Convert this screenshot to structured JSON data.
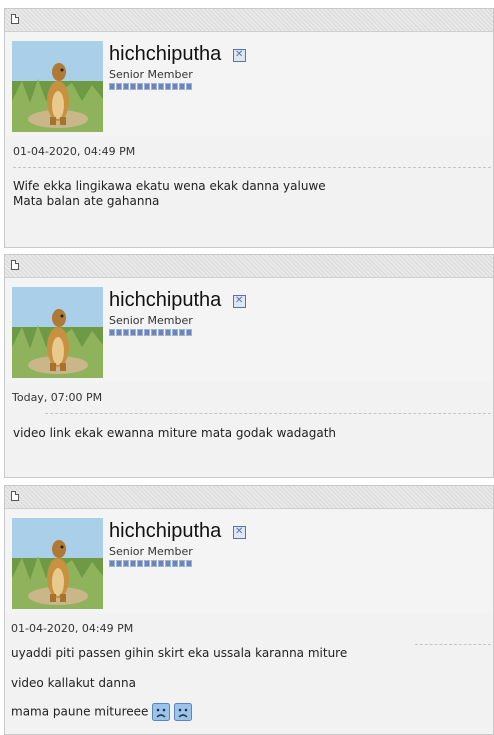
{
  "posts": [
    {
      "username": "hichchiputha",
      "usertitle": "Senior Member",
      "date": "01-04-2020, 04:49 PM",
      "lines": [
        "Wife ekka lingikawa ekatu wena ekak danna yaluwe",
        "Mata balan ate gahanna"
      ]
    },
    {
      "username": "hichchiputha",
      "usertitle": "Senior Member",
      "date": "Today, 07:00 PM",
      "lines": [
        "video link ekak ewanna miture mata godak wadagath"
      ]
    },
    {
      "username": "hichchiputha",
      "usertitle": "Senior Member",
      "date": "01-04-2020, 04:49 PM",
      "lines": [
        "uyaddi piti passen gihin skirt eka ussala karanna miture",
        "video kallakut danna",
        "mama paune mitureee"
      ]
    }
  ],
  "icons": {
    "post_icon": "document-icon",
    "status_icon": "offline-status-icon",
    "smiley": "sad-smiley-icon"
  }
}
